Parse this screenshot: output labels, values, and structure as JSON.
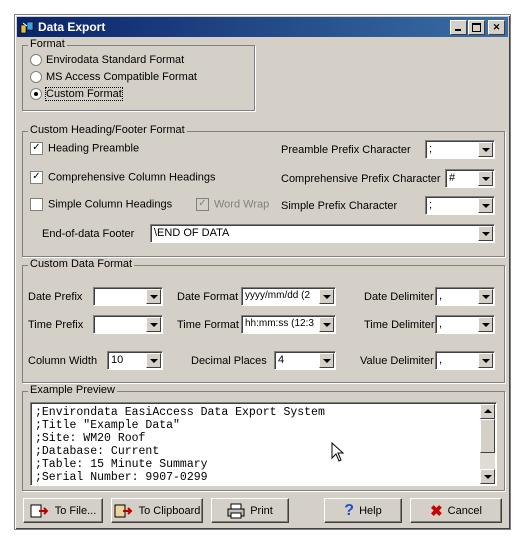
{
  "window": {
    "title": "Data Export"
  },
  "format_group": {
    "label": "Format",
    "options": [
      "Envirodata Standard Format",
      "MS Access Compatible Format",
      "Custom Format"
    ],
    "selected": 2
  },
  "heading_group": {
    "label": "Custom Heading/Footer Format",
    "heading_preamble": {
      "label": "Heading Preamble",
      "checked": true
    },
    "comprehensive_headings": {
      "label": "Comprehensive Column Headings",
      "checked": true
    },
    "simple_headings": {
      "label": "Simple Column Headings",
      "checked": false
    },
    "word_wrap": {
      "label": "Word Wrap",
      "checked": true
    },
    "preamble_prefix": {
      "label": "Preamble Prefix Character",
      "value": ";"
    },
    "comprehensive_prefix": {
      "label": "Comprehensive Prefix Character",
      "value": "#"
    },
    "simple_prefix": {
      "label": "Simple Prefix Character",
      "value": ";"
    },
    "footer": {
      "label": "End-of-data Footer",
      "value": "\\END OF DATA"
    }
  },
  "data_group": {
    "label": "Custom Data Format",
    "date_prefix": {
      "label": "Date Prefix",
      "value": ""
    },
    "date_format": {
      "label": "Date Format",
      "value": "yyyy/mm/dd (2"
    },
    "date_delimiter": {
      "label": "Date Delimiter",
      "value": ","
    },
    "time_prefix": {
      "label": "Time Prefix",
      "value": ""
    },
    "time_format": {
      "label": "Time Format",
      "value": "hh:mm:ss (12:3"
    },
    "time_delimiter": {
      "label": "Time Delimiter",
      "value": ","
    },
    "column_width": {
      "label": "Column Width",
      "value": "10"
    },
    "decimal_places": {
      "label": "Decimal Places",
      "value": "4"
    },
    "value_delimiter": {
      "label": "Value Delimiter",
      "value": ","
    }
  },
  "preview_group": {
    "label": "Example Preview",
    "text": ";Environdata EasiAccess Data Export System\n;Title \"Example Data\"\n;Site: WM20 Roof\n;Database: Current\n;Table: 15 Minute Summary\n;Serial Number: 9907-0299"
  },
  "buttons": {
    "to_file": "To File...",
    "to_clipboard": "To Clipboard",
    "print": "Print",
    "help": "Help",
    "cancel": "Cancel"
  },
  "colors": {
    "title_start": "#0a246a",
    "title_end": "#3a6ea5",
    "face": "#d4d0c8",
    "help_icon": "#1f4fd1",
    "cancel_icon": "#cc0000"
  }
}
